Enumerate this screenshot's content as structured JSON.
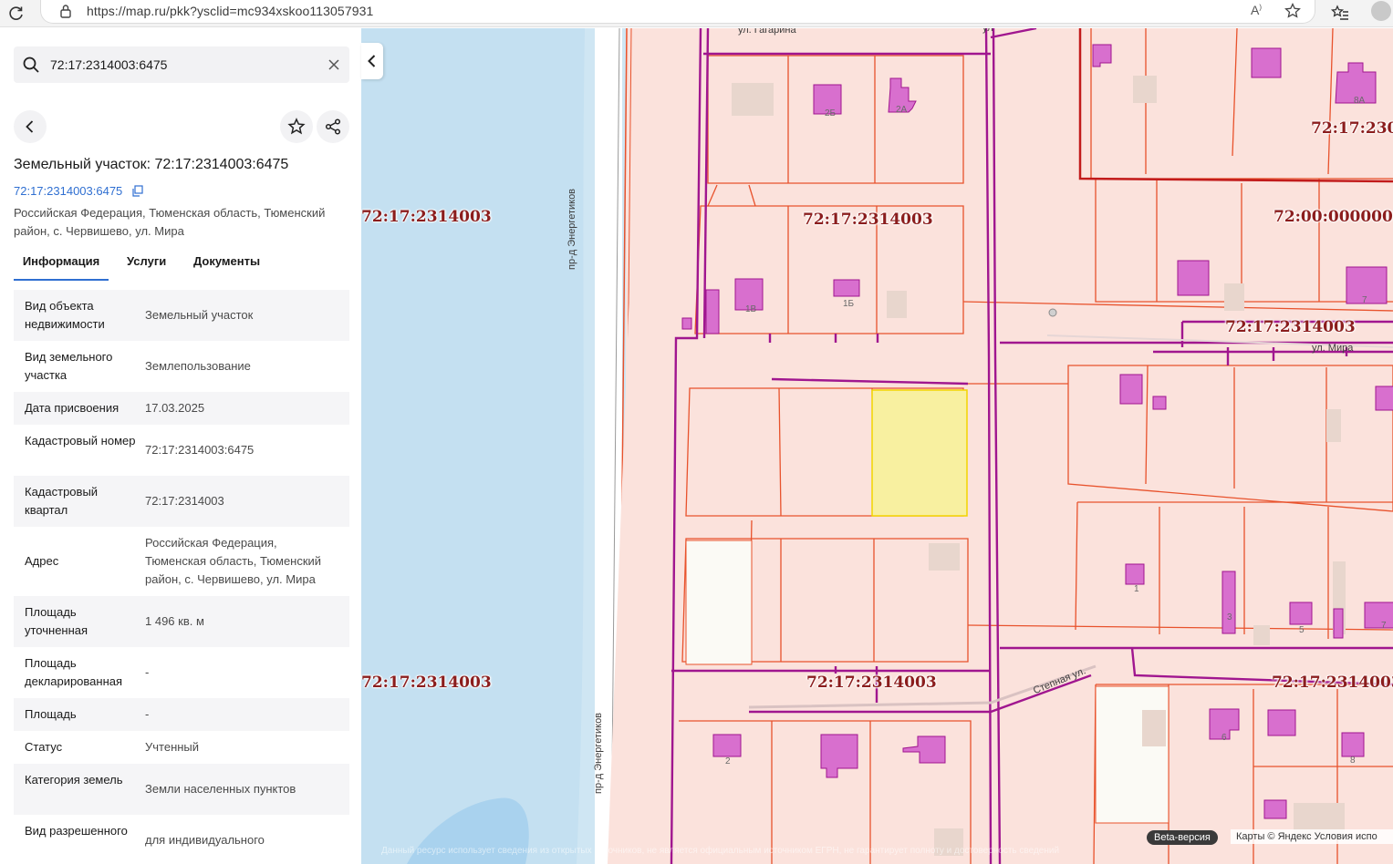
{
  "browser": {
    "url": "https://map.ru/pkk?ysclid=mc934xskoo113057931"
  },
  "search": {
    "value": "72:17:2314003:6475"
  },
  "object": {
    "title": "Земельный участок: 72:17:2314003:6475",
    "cadastral_link": "72:17:2314003:6475",
    "address": "Российская Федерация, Тюменская область, Тюменский район, с. Червишево, ул. Мира"
  },
  "tabs": [
    {
      "label": "Информация",
      "active": true
    },
    {
      "label": "Услуги",
      "active": false
    },
    {
      "label": "Документы",
      "active": false
    }
  ],
  "info_rows": [
    {
      "label": "Вид объекта недвижимости",
      "value": "Земельный участок"
    },
    {
      "label": "Вид земельного участка",
      "value": "Землепользование"
    },
    {
      "label": "Дата присвоения",
      "value": "17.03.2025"
    },
    {
      "label": "Кадастровый номер",
      "value": "72:17:2314003:6475"
    },
    {
      "label": "Кадастровый квартал",
      "value": "72:17:2314003"
    },
    {
      "label": "Адрес",
      "value": "Российская Федерация, Тюменская область, Тюменский район, с. Червишево, ул. Мира"
    },
    {
      "label": "Площадь уточненная",
      "value": "1 496 кв. м"
    },
    {
      "label": "Площадь декларированная",
      "value": "-"
    },
    {
      "label": "Площадь",
      "value": "-"
    },
    {
      "label": "Статус",
      "value": "Учтенный"
    },
    {
      "label": "Категория земель",
      "value": "Земли населенных пунктов"
    },
    {
      "label": "Вид разрешенного",
      "value": "для индивидуального"
    }
  ],
  "map": {
    "quarter_labels": [
      "72:17:2314003",
      "72:17:2314003",
      "72:17:230",
      "72:00:0000000",
      "72:17:2314003",
      "72:17:2314003",
      "72:17:2314003",
      "72:17:2314003"
    ],
    "streets": {
      "gagarina": "ул. Гагарина",
      "gagarina_cut": "ул",
      "mira": "ул. Мира",
      "energetikov": "пр-д Энергетиков",
      "stepnaya": "Степная ул."
    },
    "house_numbers": [
      "2Б",
      "2А",
      "8А",
      "1В",
      "1Б",
      "7",
      "1",
      "3",
      "5",
      "7",
      "2",
      "6",
      "8"
    ],
    "badge": "Beta-версия",
    "attribution": "Карты © Яндекс  Условия испо",
    "disclaimer": "Данный ресурс использует сведения из открытых источников, не является официальным источником ЕГРН, не гарантирует полноту и достоверность сведений",
    "colors": {
      "parcel_fill": "#fbe2dc",
      "parcel_border": "#e8522c",
      "quarter_border": "#a0168f",
      "building_fill": "#d86fce",
      "selected_fill": "#f8f0a0",
      "water": "#bcdcf0"
    }
  }
}
